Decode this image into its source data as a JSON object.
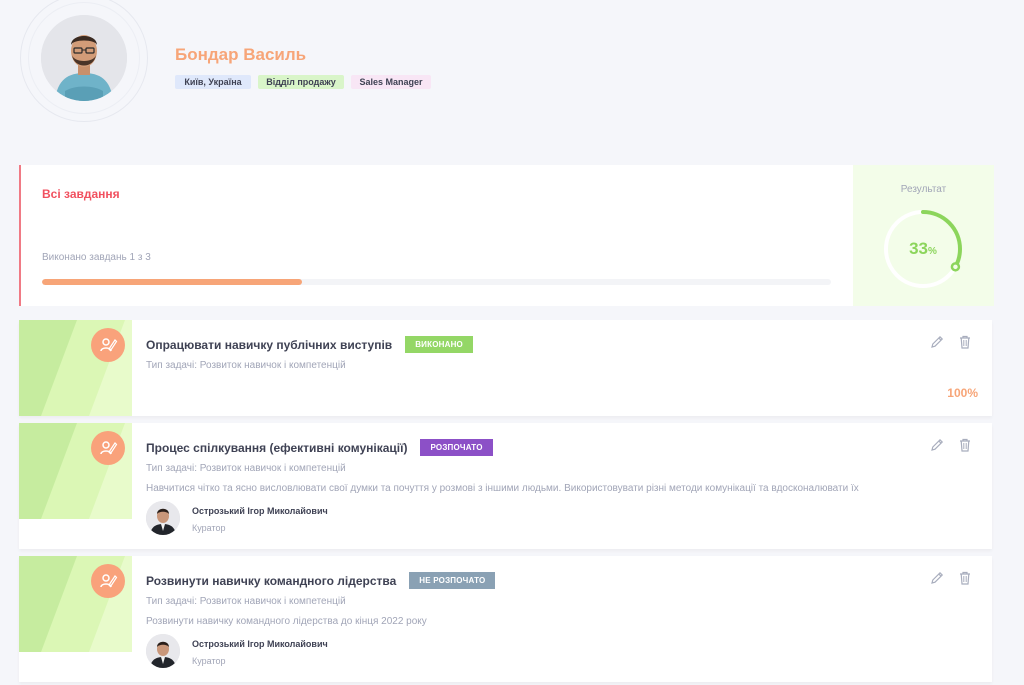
{
  "colors": {
    "accent_orange": "#f7a578",
    "accent_red": "#f1505f",
    "accent_green": "#94d766",
    "status_started": "#8c50c7",
    "status_not_started": "#8aa1b4"
  },
  "profile": {
    "name": "Бондар Василь",
    "tags": [
      "Київ, Україна",
      "Відділ продажу",
      "Sales Manager"
    ]
  },
  "summary": {
    "title": "Всі завдання",
    "progress_text": "Виконано завдань 1 з 3",
    "progress_fraction": 0.33,
    "result_label": "Результат",
    "result_value": "33",
    "result_unit": "%"
  },
  "tasks": [
    {
      "title": "Опрацювати навичку публічних виступів",
      "status": "ВИКОНАНО",
      "type": "Тип задачі: Розвиток навичок і компетенцій",
      "percent": "100%",
      "icon": "skill-icon"
    },
    {
      "title": "Процес спілкування (ефективні комунікації)",
      "status": "РОЗПОЧАТО",
      "type": "Тип задачі: Розвиток навичок і компетенцій",
      "description": "Навчитися чітко та ясно висловлювати свої думки та почуття у розмові з іншими людьми. Використовувати різні методи комунікації та вдосконалювати їх",
      "curator_name": "Острозький Ігор Миколайович",
      "curator_role": "Куратор",
      "icon": "skill-icon"
    },
    {
      "title": "Розвинути навичку командного лідерства",
      "status": "НЕ РОЗПОЧАТО",
      "type": "Тип задачі: Розвиток навичок і компетенцій",
      "description": "Розвинути навичку командного лідерства до кінця 2022 року",
      "curator_name": "Острозький Ігор Миколайович",
      "curator_role": "Куратор",
      "icon": "skill-icon"
    }
  ],
  "actions": {
    "edit_icon": "pencil-icon",
    "delete_icon": "trash-icon"
  }
}
